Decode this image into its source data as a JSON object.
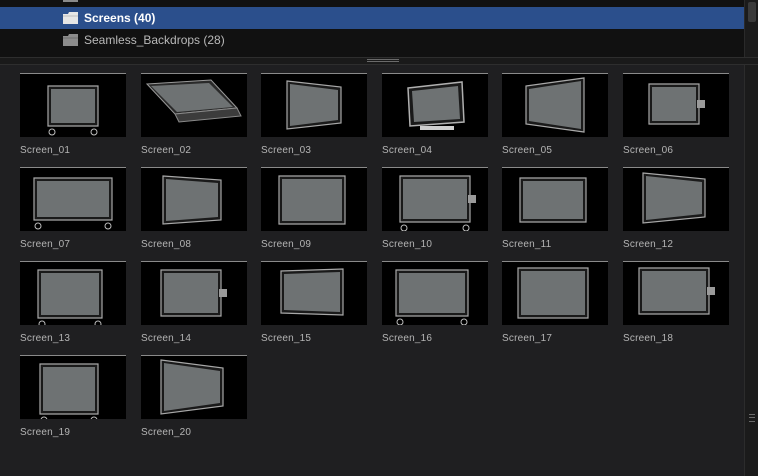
{
  "tree": {
    "partial_item": {
      "label": "",
      "count": "(··)"
    },
    "selected_item": {
      "label": "Screens (40)"
    },
    "item": {
      "label": "Seamless_Backdrops (28)"
    }
  },
  "thumbnails": [
    {
      "name": "Screen_01"
    },
    {
      "name": "Screen_02"
    },
    {
      "name": "Screen_03"
    },
    {
      "name": "Screen_04"
    },
    {
      "name": "Screen_05"
    },
    {
      "name": "Screen_06"
    },
    {
      "name": "Screen_07"
    },
    {
      "name": "Screen_08"
    },
    {
      "name": "Screen_09"
    },
    {
      "name": "Screen_10"
    },
    {
      "name": "Screen_11"
    },
    {
      "name": "Screen_12"
    },
    {
      "name": "Screen_13"
    },
    {
      "name": "Screen_14"
    },
    {
      "name": "Screen_15"
    },
    {
      "name": "Screen_16"
    },
    {
      "name": "Screen_17"
    },
    {
      "name": "Screen_18"
    },
    {
      "name": "Screen_19"
    },
    {
      "name": "Screen_20"
    }
  ],
  "colors": {
    "selection": "#2b4f8c",
    "panel": "#1f1f21",
    "screen": "#6e7273"
  }
}
